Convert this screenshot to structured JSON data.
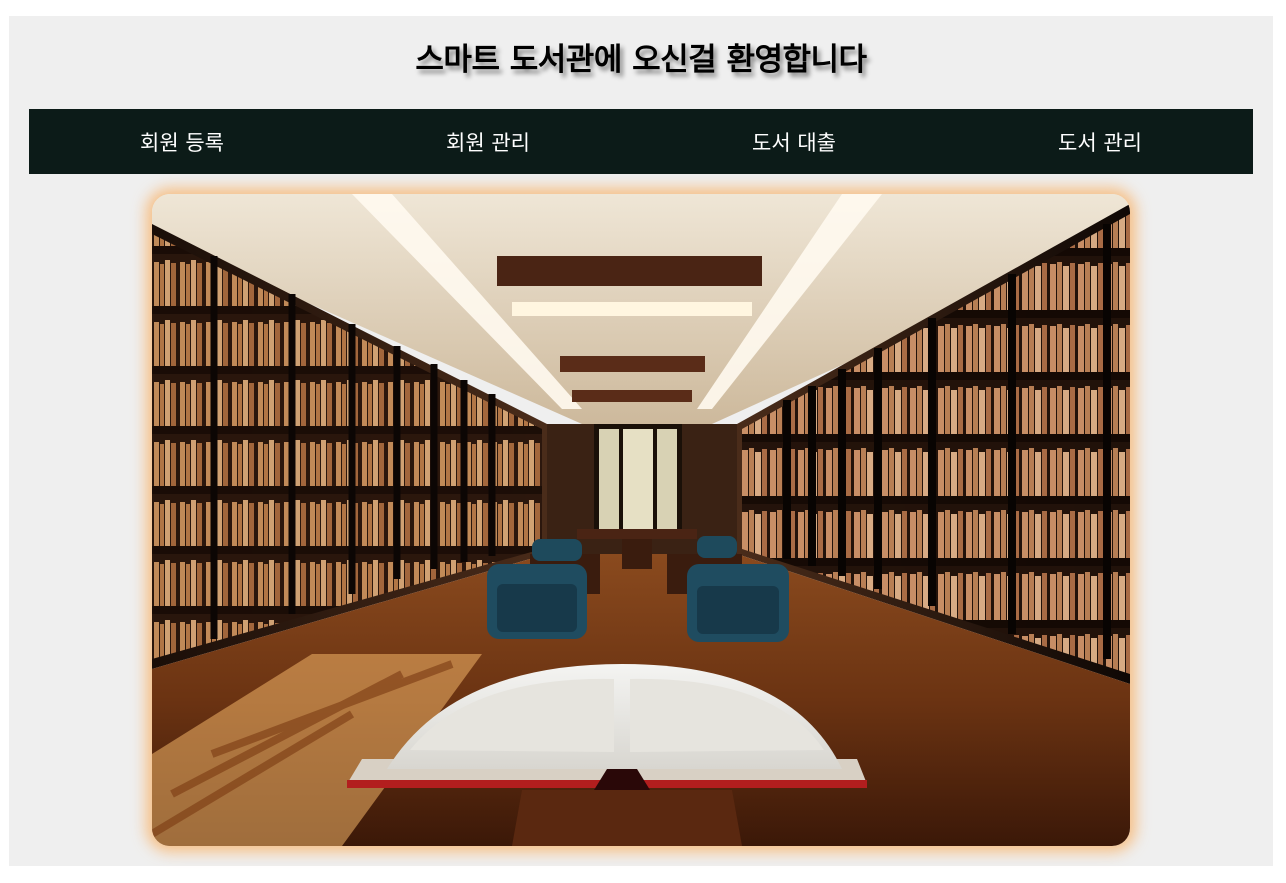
{
  "header": {
    "title": "스마트 도서관에 오신걸 환영합니다"
  },
  "nav": {
    "items": [
      {
        "label": "회원 등록"
      },
      {
        "label": "회원 관리"
      },
      {
        "label": "도서 대출"
      },
      {
        "label": "도서 관리"
      }
    ]
  },
  "colors": {
    "page_background": "#efefef",
    "nav_background": "#0c1b18",
    "nav_text": "#ffffff",
    "image_glow": "#f8b064"
  }
}
